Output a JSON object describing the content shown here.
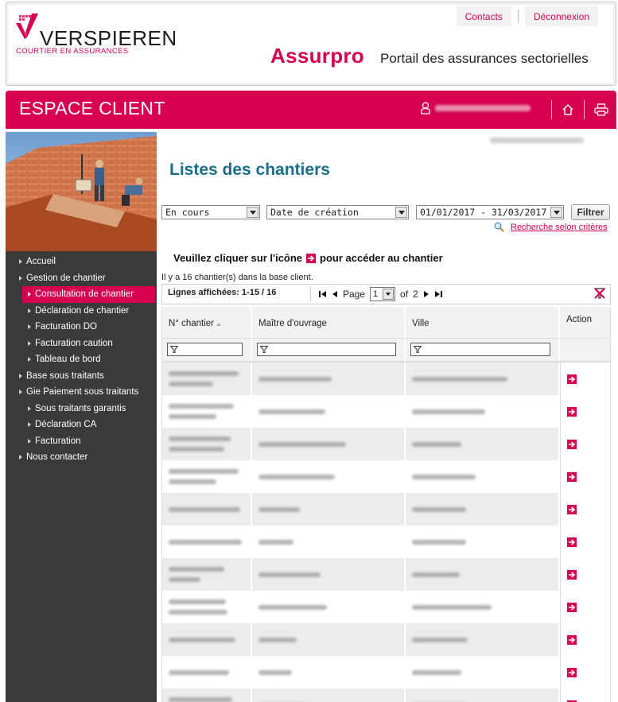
{
  "header": {
    "logo_name": "VERSPIEREN",
    "logo_subtitle": "COURTIER EN ASSURANCES",
    "links": [
      "Contacts",
      "Déconnexion"
    ],
    "brand": "Assurpro",
    "tagline": "Portail des assurances sectorielles"
  },
  "redbar": {
    "title": "ESPACE CLIENT",
    "icons": [
      "user-icon",
      "home-icon",
      "print-icon"
    ]
  },
  "sidebar": {
    "items": [
      {
        "label": "Accueil",
        "level": 1
      },
      {
        "label": "Gestion de chantier",
        "level": 1
      },
      {
        "label": "Consultation de chantier",
        "level": 2,
        "active": true
      },
      {
        "label": "Déclaration de chantier",
        "level": 2
      },
      {
        "label": "Facturation DO",
        "level": 2
      },
      {
        "label": "Facturation caution",
        "level": 2
      },
      {
        "label": "Tableau de bord",
        "level": 2
      },
      {
        "label": "Base sous traitants",
        "level": 1
      },
      {
        "label": "Gie Paiement sous traitants",
        "level": 1
      },
      {
        "label": "Sous traitants garantis",
        "level": 2
      },
      {
        "label": "Déclaration CA",
        "level": 2
      },
      {
        "label": "Facturation",
        "level": 2
      },
      {
        "label": "Nous contacter",
        "level": 1
      }
    ]
  },
  "main": {
    "title": "Listes des chantiers",
    "filters": {
      "status": "En cours",
      "date_type": "Date de création",
      "date_range": "01/01/2017 - 31/03/2017",
      "button": "Filtrer",
      "advanced_link": "Recherche selon critères"
    },
    "instruction_before": "Veuillez cliquer sur l'icône",
    "instruction_after": "pour accéder au chantier",
    "count_text": "Il y a 16 chantier(s) dans la base client.",
    "pager": {
      "lines_label": "Lignes affichées: 1-15 / 16",
      "page_label": "Page",
      "current_page": "1",
      "of_label": "of",
      "total_pages": "2"
    },
    "columns": [
      "N° chantier",
      "Maître d'ouvrage",
      "Ville",
      "Action"
    ],
    "row_count": 11
  },
  "colors": {
    "accent": "#d6004f",
    "title_blue": "#1a6e8c",
    "sidebar_bg": "#3a3a3a"
  }
}
